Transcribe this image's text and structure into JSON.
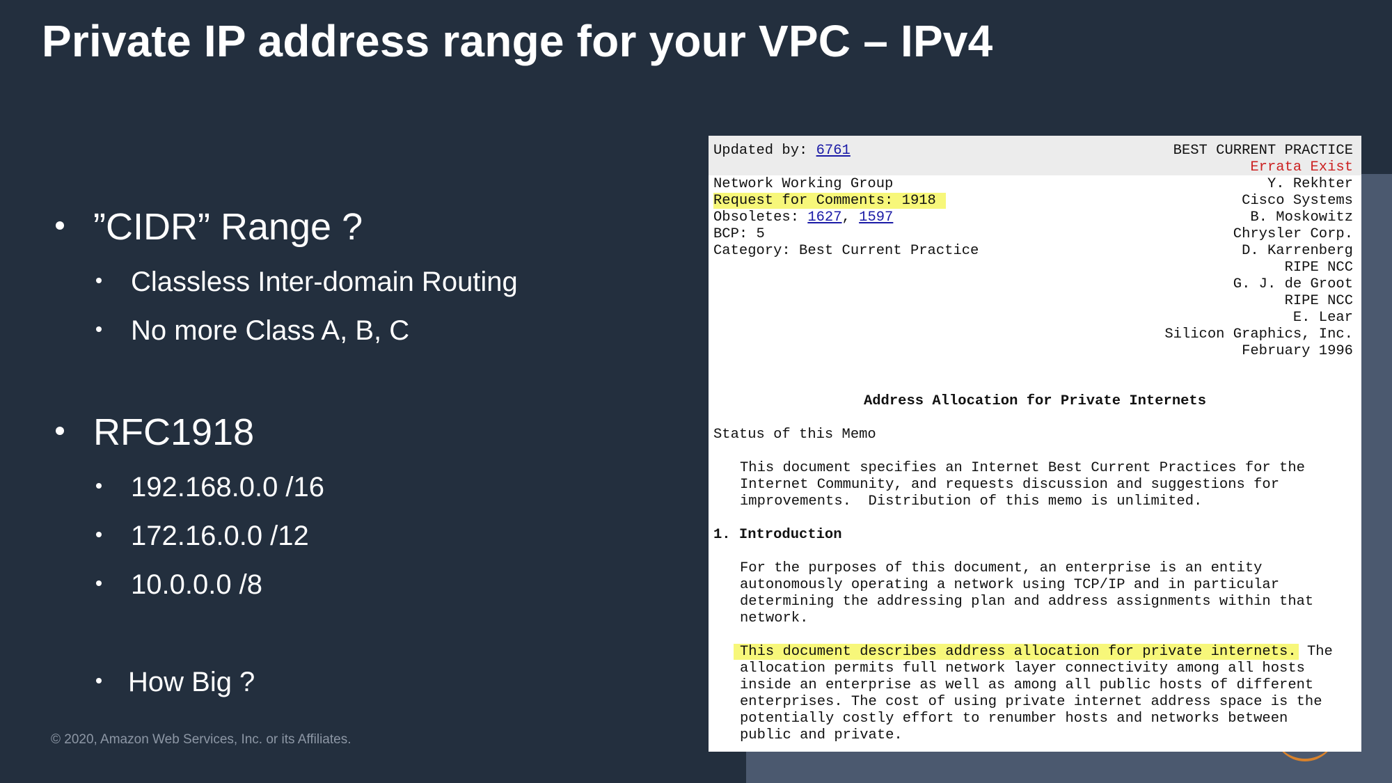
{
  "slide": {
    "title": "Private IP address range for your VPC – IPv4",
    "copyright": "© 2020, Amazon Web Services, Inc. or its Affiliates."
  },
  "bullets": {
    "cidr": "”CIDR” Range ?",
    "cidr_sub": [
      "Classless Inter-domain Routing",
      "No more Class A, B, C"
    ],
    "rfc": "RFC1918",
    "rfc_sub": [
      "192.168.0.0 /16",
      "172.16.0.0 /12",
      "10.0.0.0 /8"
    ],
    "how_big": "How Big ?"
  },
  "rfc_doc": {
    "updated_by_label": "Updated by: ",
    "updated_by_link": "6761",
    "status": "BEST CURRENT PRACTICE",
    "errata": "Errata Exist",
    "left_header": {
      "group": "Network Working Group",
      "rfc": "Request for Comments: 1918",
      "obsoletes_label": "Obsoletes: ",
      "obsoletes_link1": "1627",
      "obsoletes_sep": ", ",
      "obsoletes_link2": "1597",
      "bcp": "BCP: 5",
      "category": "Category: Best Current Practice"
    },
    "authors": [
      "Y. Rekhter",
      "Cisco Systems",
      "B. Moskowitz",
      "Chrysler Corp.",
      "D. Karrenberg",
      "RIPE NCC",
      "G. J. de Groot",
      "RIPE NCC",
      "E. Lear",
      "Silicon Graphics, Inc.",
      "February 1996"
    ],
    "doc_title": "Address Allocation for Private Internets",
    "status_heading": "Status of this Memo",
    "status_text": [
      "This document specifies an Internet Best Current Practices for the",
      "Internet Community, and requests discussion and suggestions for",
      "improvements.  Distribution of this memo is unlimited."
    ],
    "intro_heading": "1. Introduction",
    "intro_text": [
      "For the purposes of this document, an enterprise is an entity",
      "autonomously operating a network using TCP/IP and in particular",
      "determining the addressing plan and address assignments within that",
      "network."
    ],
    "para2_highlight": "This document describes address allocation for private internets.",
    "para2_first_rest": " The",
    "para2_text": [
      "allocation permits full network layer connectivity among all hosts",
      "inside an enterprise as well as among all public hosts of different",
      "enterprises. The cost of using private internet address space is the",
      "potentially costly effort to renumber hosts and networks between",
      "public and private."
    ]
  }
}
